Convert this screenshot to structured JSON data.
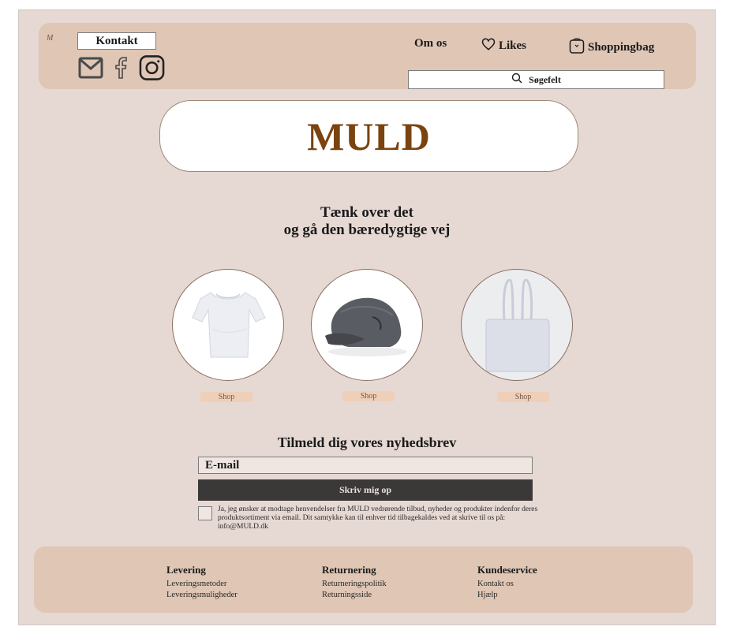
{
  "header": {
    "logo_mini": "M",
    "contact_label": "Kontakt",
    "social": [
      "mail-icon",
      "facebook-icon",
      "instagram-icon"
    ],
    "nav": {
      "about": "Om os",
      "likes": "Likes",
      "bag": "Shoppingbag"
    },
    "search_label": "Søgefelt"
  },
  "brand": {
    "name": "MULD",
    "color": "#7b4310"
  },
  "tagline": {
    "line1": "Tænk over det",
    "line2": "og gå den bæredygtige vej"
  },
  "products": [
    {
      "image": "t-shirt",
      "shop_label": "Shop"
    },
    {
      "image": "cap",
      "shop_label": "Shop"
    },
    {
      "image": "tote-bag",
      "shop_label": "Shop"
    }
  ],
  "newsletter": {
    "title": "Tilmeld dig vores nyhedsbrev",
    "email_placeholder": "E-mail",
    "submit_label": "Skriv mig op",
    "consent": "Ja, jeg ønsker at modtage henvendelser fra MULD vedrørende tilbud, nyheder og produkter indenfor deres produktsortiment via email. Dit samtykke kan til enhver tid tilbagekaldes ved at skrive til os på: info@MULD.dk"
  },
  "footer": {
    "columns": [
      {
        "title": "Levering",
        "links": [
          "Leveringsmetoder",
          "Leveringsmuligheder"
        ]
      },
      {
        "title": "Returnering",
        "links": [
          "Returneringspolitik",
          "Returningsside"
        ]
      },
      {
        "title": "Kundeservice",
        "links": [
          "Kontakt os",
          "Hjælp"
        ]
      }
    ]
  },
  "colors": {
    "background": "#e6d8d3",
    "header": "#dfc6b5",
    "button_dark": "#3b3838",
    "shop_button": "#efcfb8"
  }
}
